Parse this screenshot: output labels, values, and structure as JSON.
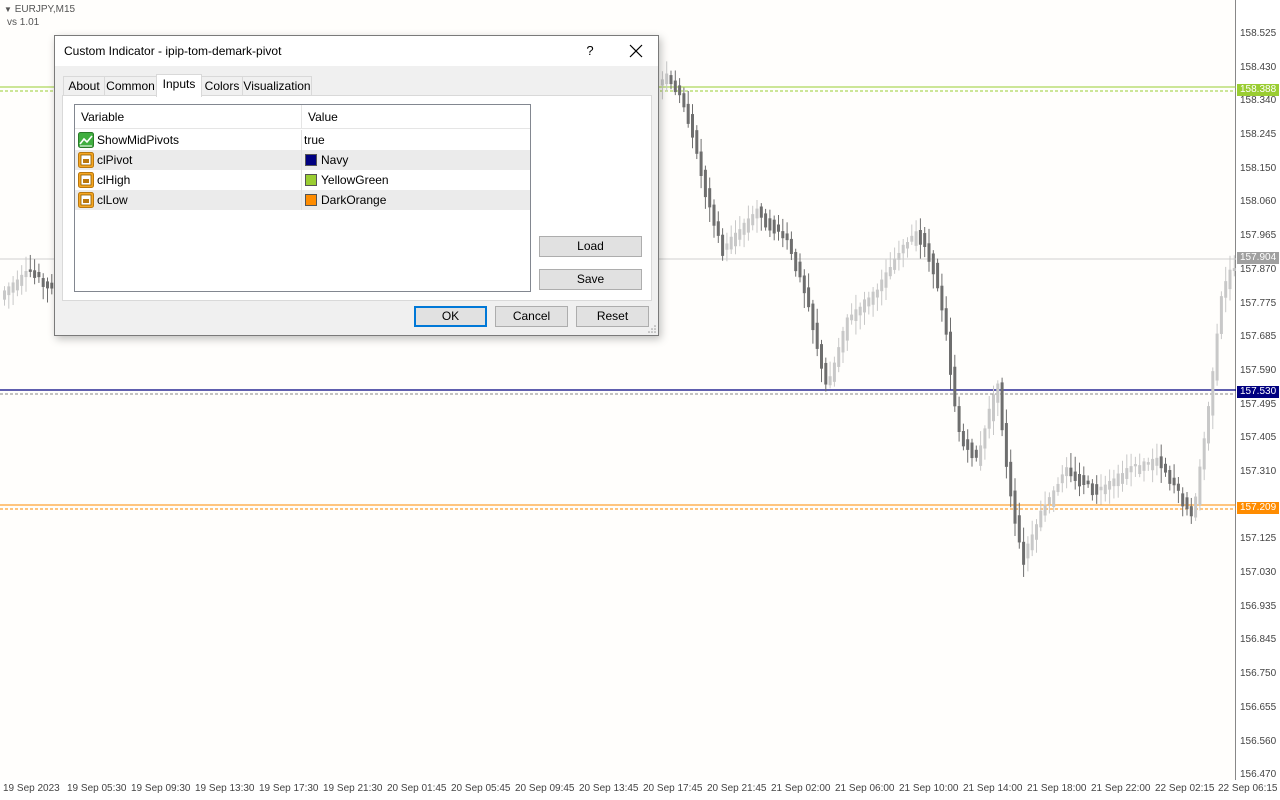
{
  "chart": {
    "symbol_label": "EURJPY,M15",
    "version_label": "vs 1.01",
    "price_ticks": [
      "158.525",
      "158.430",
      "158.340",
      "158.245",
      "158.150",
      "158.060",
      "157.965",
      "157.870",
      "157.775",
      "157.685",
      "157.590",
      "157.495",
      "157.405",
      "157.310",
      "157.125",
      "157.030",
      "156.935",
      "156.845",
      "156.750",
      "156.655",
      "156.560",
      "156.470"
    ],
    "price_tags": [
      {
        "label": "158.388",
        "color": "#9acd32"
      },
      {
        "label": "157.904",
        "color": "#a0a0a0"
      },
      {
        "label": "157.530",
        "color": "#000080"
      },
      {
        "label": "157.209",
        "color": "#ff8c00"
      }
    ],
    "time_ticks": [
      "19 Sep 2023",
      "19 Sep 05:30",
      "19 Sep 09:30",
      "19 Sep 13:30",
      "19 Sep 17:30",
      "19 Sep 21:30",
      "20 Sep 01:45",
      "20 Sep 05:45",
      "20 Sep 09:45",
      "20 Sep 13:45",
      "20 Sep 17:45",
      "20 Sep 21:45",
      "21 Sep 02:00",
      "21 Sep 06:00",
      "21 Sep 10:00",
      "21 Sep 14:00",
      "21 Sep 18:00",
      "21 Sep 22:00",
      "22 Sep 02:15",
      "22 Sep 06:15"
    ],
    "colors": {
      "pivot": "#000080",
      "high": "#9acd32",
      "low": "#ff8c00",
      "candle_dark": "#6e6e6e",
      "candle_light": "#c8c8c8"
    }
  },
  "dialog": {
    "title": "Custom Indicator - ipip-tom-demark-pivot",
    "help_label": "?",
    "tabs": [
      {
        "label": "About",
        "active": false
      },
      {
        "label": "Common",
        "active": false
      },
      {
        "label": "Inputs",
        "active": true
      },
      {
        "label": "Colors",
        "active": false
      },
      {
        "label": "Visualization",
        "active": false
      }
    ],
    "grid": {
      "headers": {
        "variable": "Variable",
        "value": "Value"
      },
      "rows": [
        {
          "variable": "ShowMidPivots",
          "value": "true",
          "icon": "bool-chart-icon"
        },
        {
          "variable": "clPivot",
          "value": "Navy",
          "icon": "color-param-icon",
          "swatch": "#000080"
        },
        {
          "variable": "clHigh",
          "value": "YellowGreen",
          "icon": "color-param-icon",
          "swatch": "#9acd32"
        },
        {
          "variable": "clLow",
          "value": "DarkOrange",
          "icon": "color-param-icon",
          "swatch": "#ff8c00"
        }
      ]
    },
    "buttons": {
      "load": "Load",
      "save": "Save",
      "ok": "OK",
      "cancel": "Cancel",
      "reset": "Reset"
    }
  }
}
